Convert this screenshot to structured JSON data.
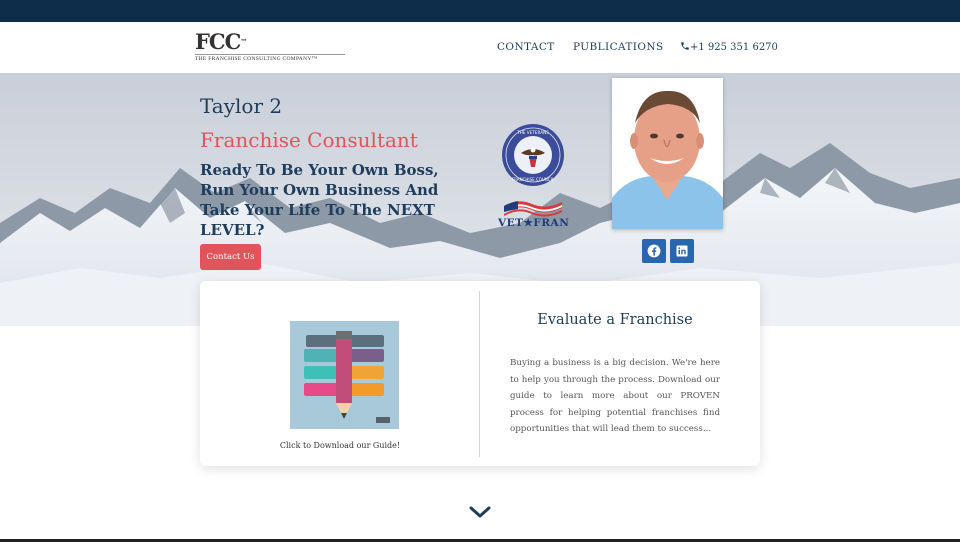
{
  "header": {
    "logo": {
      "mark": "FCC",
      "tm": "™",
      "subtitle": "THE FRANCHISE CONSULTING COMPANY™"
    },
    "nav": [
      {
        "label": "CONTACT"
      },
      {
        "label": "PUBLICATIONS"
      }
    ],
    "phone": "+1 925 351 6270"
  },
  "hero": {
    "name": "Taylor 2",
    "role": "Franchise Consultant",
    "tagline": "Ready To Be Your Own Boss, Run Your Own Business And Take Your Life To The NEXT LEVEL?",
    "contact_button": "Contact Us",
    "badges": {
      "seal": {
        "icon": "veterans-franchise-council-seal-icon",
        "top_text": "THE VETERANS",
        "bottom_text": "FRANCHISE COUNCIL"
      },
      "vetfran": {
        "icon": "vetfran-flag-icon",
        "text": "VET★FRAN"
      }
    },
    "social": [
      {
        "icon": "facebook-icon"
      },
      {
        "icon": "linkedin-icon"
      }
    ]
  },
  "card": {
    "guide_caption": "Click to Download our Guide!",
    "eval_title": "Evaluate a Franchise",
    "eval_body": "Buying a business is a big decision. We're here to help you through the process. Download our guide to learn more about our PROVEN process for helping potential franchises find opportunities that will lead them to success..."
  },
  "scroll_icon": "chevron-down-icon",
  "colors": {
    "navy": "#1e3d5c",
    "topbar": "#0e2d4a",
    "accent_red": "#e2545c",
    "social_blue": "#2866b0"
  }
}
